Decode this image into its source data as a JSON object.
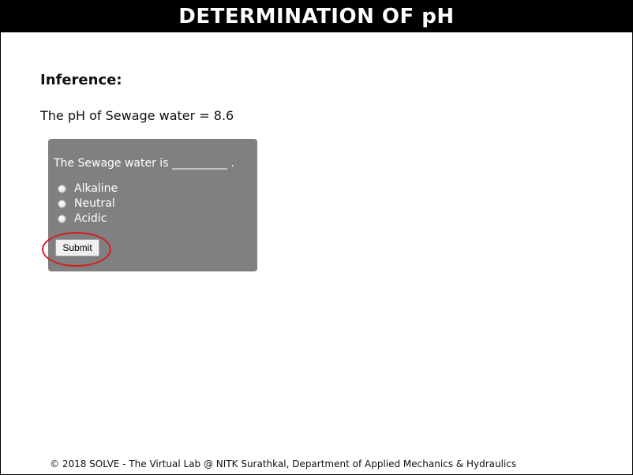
{
  "header": {
    "title": "DETERMINATION OF pH"
  },
  "main": {
    "heading": "Inference:",
    "result": "The pH of Sewage water = 8.6",
    "quiz": {
      "question": "The Sewage water is __________ .",
      "options": [
        {
          "label": "Alkaline",
          "selected": false
        },
        {
          "label": "Neutral",
          "selected": false
        },
        {
          "label": "Acidic",
          "selected": false
        }
      ],
      "submit_label": "Submit"
    }
  },
  "footer": {
    "text": "© 2018 SOLVE - The Virtual Lab @ NITK Surathkal, Department of Applied Mechanics & Hydraulics"
  },
  "colors": {
    "title_bar_bg": "#000000",
    "quiz_box_bg": "#808080",
    "highlight_ring": "#d02020"
  }
}
